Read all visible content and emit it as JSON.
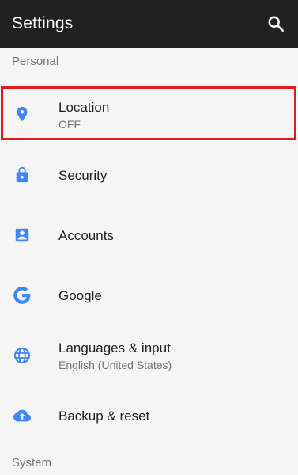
{
  "app_bar": {
    "title": "Settings",
    "search_icon": "search-icon",
    "background": "#212121"
  },
  "sections": {
    "personal": "Personal",
    "system": "System"
  },
  "items": [
    {
      "title": "Location",
      "subtitle": "OFF",
      "icon": "location-pin-icon"
    },
    {
      "title": "Security",
      "icon": "lock-icon"
    },
    {
      "title": "Accounts",
      "icon": "account-box-icon"
    },
    {
      "title": "Google",
      "icon": "google-g-icon"
    },
    {
      "title": "Languages & input",
      "subtitle": "English (United States)",
      "icon": "globe-icon"
    },
    {
      "title": "Backup & reset",
      "icon": "cloud-upload-icon"
    }
  ],
  "colors": {
    "accent": "#4285f4",
    "highlight": "#e01b1b",
    "background": "#f5f5f5"
  }
}
